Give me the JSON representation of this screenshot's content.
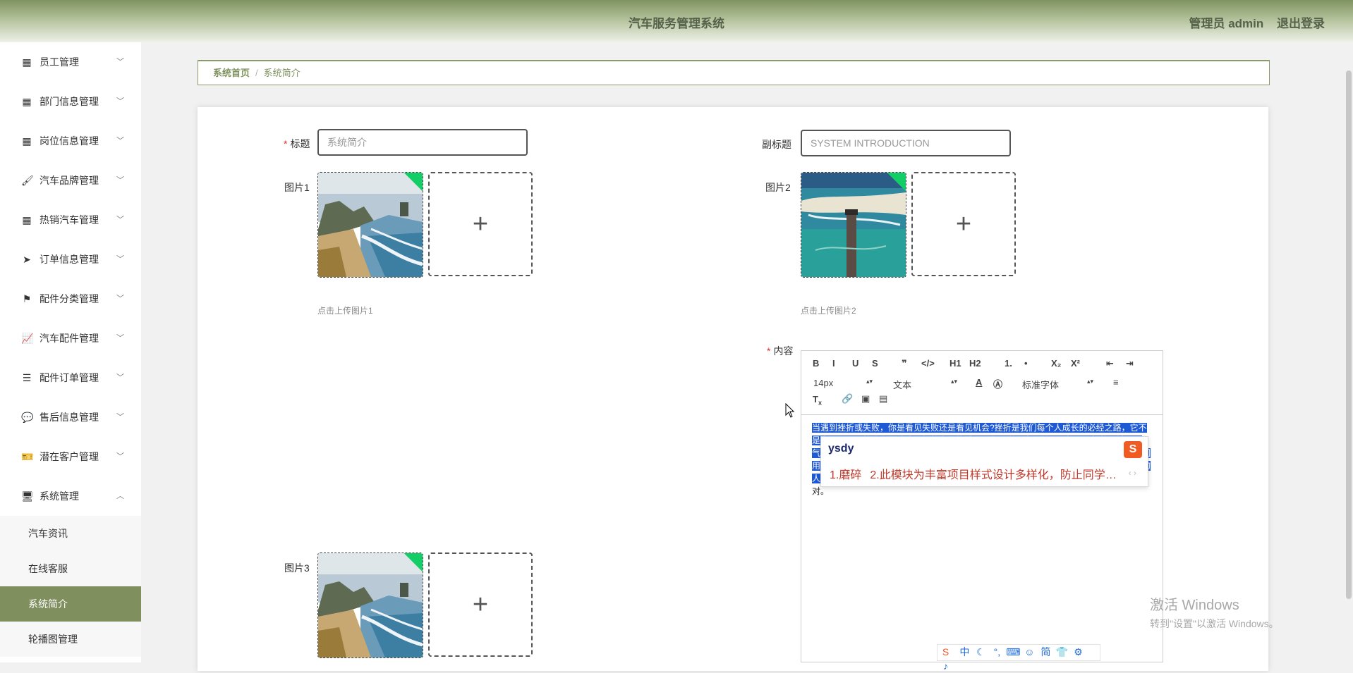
{
  "header": {
    "title": "汽车服务管理系统",
    "role": "管理员 admin",
    "logout": "退出登录"
  },
  "sidebar": {
    "items": [
      {
        "icon": "grid-icon",
        "label": "员工管理"
      },
      {
        "icon": "grid-icon",
        "label": "部门信息管理"
      },
      {
        "icon": "grid-icon",
        "label": "岗位信息管理"
      },
      {
        "icon": "brush-icon",
        "label": "汽车品牌管理"
      },
      {
        "icon": "grid-icon",
        "label": "热销汽车管理"
      },
      {
        "icon": "send-icon",
        "label": "订单信息管理"
      },
      {
        "icon": "flag-icon",
        "label": "配件分类管理"
      },
      {
        "icon": "trend-chart-icon",
        "label": "汽车配件管理"
      },
      {
        "icon": "list-icon",
        "label": "配件订单管理"
      },
      {
        "icon": "chat-icon",
        "label": "售后信息管理"
      },
      {
        "icon": "ticket-icon",
        "label": "潜在客户管理"
      },
      {
        "icon": "monitor-icon",
        "label": "系统管理"
      }
    ],
    "subitems": [
      {
        "label": "汽车资讯"
      },
      {
        "label": "在线客服"
      },
      {
        "label": "系统简介"
      },
      {
        "label": "轮播图管理"
      }
    ]
  },
  "breadcrumb": {
    "home": "系统首页",
    "separator": "/",
    "current": "系统简介"
  },
  "form": {
    "title_label": "标题",
    "title_value": "",
    "title_placeholder": "系统简介",
    "subtitle_label": "副标题",
    "subtitle_value": "",
    "subtitle_placeholder": "SYSTEM INTRODUCTION",
    "pic1_label": "图片1",
    "pic1_hint": "点击上传图片1",
    "pic2_label": "图片2",
    "pic2_hint": "点击上传图片2",
    "pic3_label": "图片3",
    "content_label": "内容",
    "required_mark": "*"
  },
  "editor": {
    "toolbar_row1": [
      "B",
      "I",
      "U",
      "S",
      "❞",
      "</>",
      "H1",
      "H2",
      "1.",
      "•",
      "X₂",
      "X²",
      "⇤",
      "⇥"
    ],
    "font_size": "14px",
    "paragraph": "文本",
    "font_family": "标准字体",
    "text_highlighted": "当遇到挫折或失败，你是看见失败还是看见机会?挫折是我们每个人成长的必经之路，它不是失败，而是将我们塑造成更好的自己的过程。有人说，失败并不可怕，可怕的是缺乏勇气；在面对困难时，勇敢向前，不轻言放弃。人生路上总会遇到困难与挫折，关键在于我们用怎样的态度去面对它。要学会在失败中成长的人，一生当中，最痛苦的经验是失去所爱的人，其次是丢掉一份",
    "text_normal": "工作。其实，经得起考验的人，就算是被开除也不会惊慌，要学会面对。"
  },
  "ime": {
    "pinyin": "ysdy",
    "candidates": [
      "1.磨碎",
      "2.此模块为丰富项目样式设计多样化，防止同学…"
    ],
    "nav": "‹ ›",
    "toolbar": [
      "中",
      "☾",
      "°,",
      "⌨",
      "☺",
      "简",
      "👕",
      "⚙",
      "♪"
    ]
  },
  "watermark": {
    "line1": "激活 Windows",
    "line2": "转到\"设置\"以激活 Windows。"
  },
  "colors": {
    "accent": "#7f8f5e",
    "header_text": "#55624a",
    "badge_green": "#13ce66",
    "required": "#e0302a"
  }
}
